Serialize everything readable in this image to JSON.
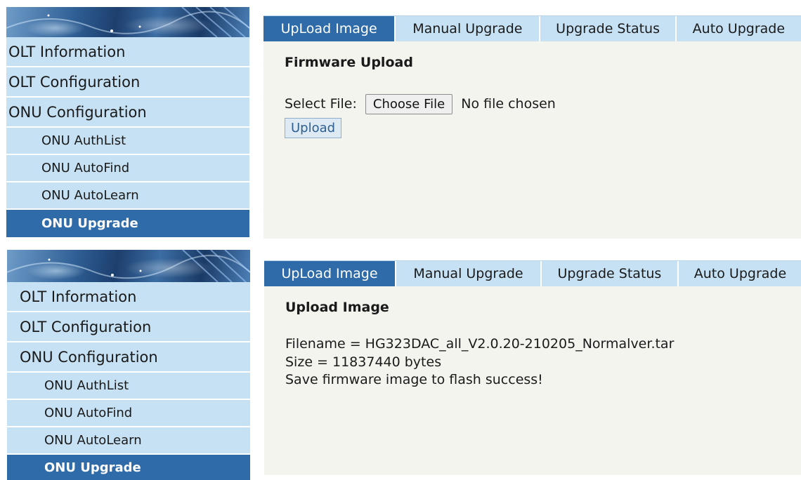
{
  "top": {
    "sidebar": {
      "main_items": [
        "OLT Information",
        "OLT Configuration",
        "ONU Configuration"
      ],
      "sub_items": [
        "ONU AuthList",
        "ONU AutoFind",
        "ONU AutoLearn",
        "ONU Upgrade"
      ],
      "active_sub": "ONU Upgrade"
    },
    "tabs": [
      "UpLoad Image",
      "Manual Upgrade",
      "Upgrade Status",
      "Auto Upgrade"
    ],
    "active_tab": "UpLoad Image",
    "heading": "Firmware Upload",
    "select_file_label": "Select File:",
    "choose_file_label": "Choose File",
    "file_status": "No file chosen",
    "upload_label": "Upload"
  },
  "bottom": {
    "sidebar": {
      "main_items": [
        "OLT Information",
        "OLT Configuration",
        "ONU Configuration"
      ],
      "sub_items": [
        "ONU AuthList",
        "ONU AutoFind",
        "ONU AutoLearn",
        "ONU Upgrade"
      ],
      "active_sub": "ONU Upgrade"
    },
    "tabs": [
      "UpLoad Image",
      "Manual Upgrade",
      "Upgrade Status",
      "Auto Upgrade"
    ],
    "active_tab": "UpLoad Image",
    "heading": "Upload Image",
    "filename_line": "Filename = HG323DAC_all_V2.0.20-210205_Normalver.tar",
    "size_line": "Size = 11837440 bytes",
    "result_line": "Save firmware image to flash success!"
  },
  "colors": {
    "nav_bg": "#c6e1f4",
    "active_bg": "#2f6ba8",
    "content_bg": "#f4f4ef"
  }
}
